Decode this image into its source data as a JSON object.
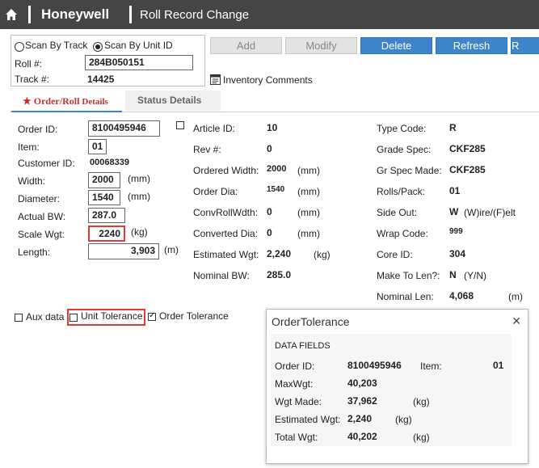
{
  "header": {
    "brand": "Honeywell",
    "title": "Roll Record Change"
  },
  "scan": {
    "option_track": "Scan By Track",
    "option_unit": "Scan By Unit ID",
    "selected": "unit",
    "roll_label": "Roll #:",
    "roll_value": "284B050151",
    "track_label": "Track #:",
    "track_value": "14425"
  },
  "toolbar": {
    "add": "Add",
    "modify": "Modify",
    "delete": "Delete",
    "refresh": "Refresh",
    "next": "R",
    "inventory_comments": "Inventory Comments"
  },
  "tabs": {
    "order_roll_star": "★",
    "order_roll": "Order/Roll",
    "order_roll_sub": "Details",
    "status": "Status Details"
  },
  "col1": {
    "order_id_label": "Order ID:",
    "order_id": "8100495946",
    "item_label": "Item:",
    "item": "01",
    "customer_id_label": "Customer ID:",
    "customer_id": "00068339",
    "width_label": "Width:",
    "width": "2000",
    "width_unit": "(mm)",
    "diameter_label": "Diameter:",
    "diameter": "1540",
    "diameter_unit": "(mm)",
    "actual_bw_label": "Actual BW:",
    "actual_bw": "287.0",
    "scale_wgt_label": "Scale Wgt:",
    "scale_wgt": "2240",
    "scale_wgt_unit": "(kg)",
    "length_label": "Length:",
    "length": "3,903",
    "length_unit": "(m)"
  },
  "col2": {
    "article_id_label": "Article ID:",
    "article_id": "10",
    "rev_label": "Rev #:",
    "rev": "0",
    "ordered_width_label": "Ordered Width:",
    "ordered_width": "2000",
    "ordered_width_unit": "(mm)",
    "order_dia_label": "Order Dia:",
    "order_dia": "1540",
    "order_dia_unit": "(mm)",
    "convrollwdth_label": "ConvRollWdth:",
    "convrollwdth": "0",
    "convrollwdth_unit": "(mm)",
    "converted_dia_label": "Converted Dia:",
    "converted_dia": "0",
    "converted_dia_unit": "(mm)",
    "estimated_wgt_label": "Estimated Wgt:",
    "estimated_wgt": "2,240",
    "estimated_wgt_unit": "(kg)",
    "nominal_bw_label": "Nominal BW:",
    "nominal_bw": "285.0"
  },
  "col3": {
    "type_code_label": "Type Code:",
    "type_code": "R",
    "grade_spec_label": "Grade Spec:",
    "grade_spec": "CKF285",
    "gr_spec_made_label": "Gr Spec Made:",
    "gr_spec_made": "CKF285",
    "rolls_pack_label": "Rolls/Pack:",
    "rolls_pack": "01",
    "side_out_label": "Side Out:",
    "side_out": "W",
    "side_out_hint": "(W)ire/(F)elt",
    "wrap_code_label": "Wrap Code:",
    "wrap_code": "999",
    "core_id_label": "Core ID:",
    "core_id": "304",
    "make_to_len_label": "Make To Len?:",
    "make_to_len": "N",
    "make_to_len_hint": "(Y/N)",
    "nominal_len_label": "Nominal Len:",
    "nominal_len": "4,068",
    "nominal_len_unit": "(m)"
  },
  "options": {
    "aux_data": "Aux data",
    "aux_checked": false,
    "unit_tolerance": "Unit Tolerance",
    "unit_checked": false,
    "order_tolerance": "Order Tolerance",
    "order_checked": true
  },
  "popup": {
    "title": "OrderTolerance",
    "section": "DATA FIELDS",
    "order_id_label": "Order ID:",
    "order_id": "8100495946",
    "item_label": "Item:",
    "item": "01",
    "maxwgt_label": "MaxWgt:",
    "maxwgt": "40,203",
    "wgt_made_label": "Wgt Made:",
    "wgt_made": "37,962",
    "wgt_made_unit": "(kg)",
    "est_wgt_label": "Estimated Wgt:",
    "est_wgt": "2,240",
    "est_wgt_unit": "(kg)",
    "total_wgt_label": "Total Wgt:",
    "total_wgt": "40,202",
    "total_wgt_unit": "(kg)"
  },
  "colors": {
    "header_bg": "#454545",
    "primary_button": "#3d84cc",
    "highlight": "#e53935",
    "active_tab_text": "#c0302d"
  }
}
